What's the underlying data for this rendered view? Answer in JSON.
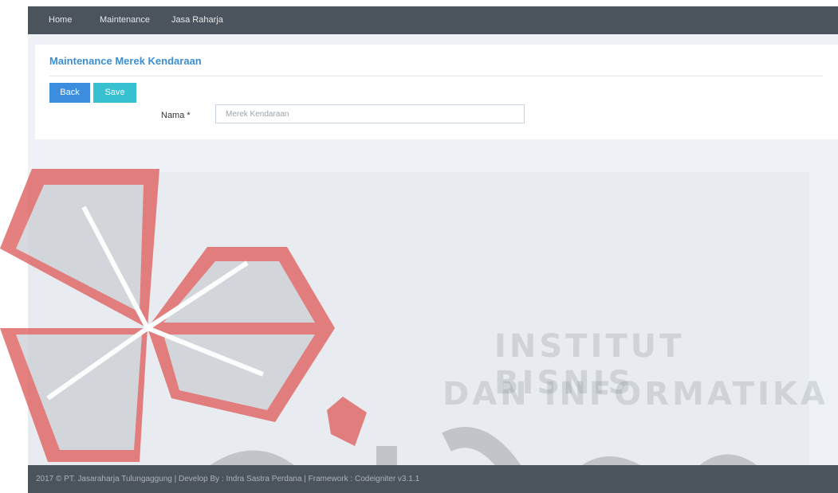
{
  "nav": {
    "items": [
      {
        "label": "Home"
      },
      {
        "label": "Maintenance"
      },
      {
        "label": "Jasa Raharja"
      }
    ]
  },
  "panel": {
    "title": "Maintenance Merek Kendaraan",
    "back_label": "Back",
    "save_label": "Save",
    "field_label": "Nama *",
    "field_placeholder": "Merek Kendaraan",
    "field_value": ""
  },
  "watermark": {
    "line1": "INSTITUT BISNIS",
    "line2": "DAN INFORMATIKA",
    "brand_wordmark": "stikom"
  },
  "footer": {
    "text": "2017 © PT. Jasaraharja Tulungaggung | Develop By : Indra Sastra Perdana | Framework : Codeigniter v3.1.1"
  },
  "colors": {
    "navbar": "#4b535c",
    "title_blue": "#3b8fd0",
    "back_button": "#3c8dde",
    "save_button": "#36c0d0",
    "watermark_red": "#e06a6a",
    "watermark_gray": "#c8ccd2"
  }
}
